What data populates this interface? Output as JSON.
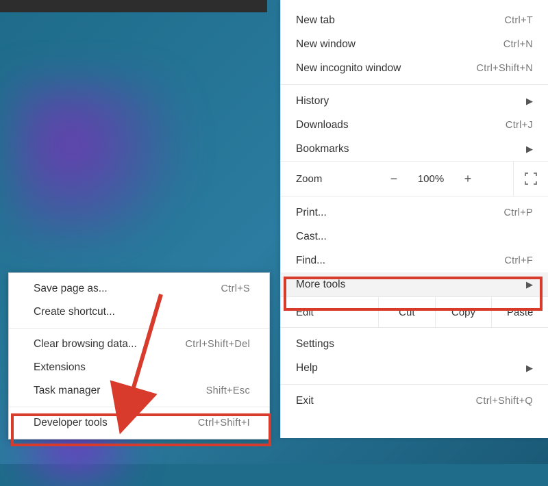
{
  "main_menu": {
    "new_tab": {
      "label": "New tab",
      "shortcut": "Ctrl+T"
    },
    "new_window": {
      "label": "New window",
      "shortcut": "Ctrl+N"
    },
    "new_incognito": {
      "label": "New incognito window",
      "shortcut": "Ctrl+Shift+N"
    },
    "history": {
      "label": "History"
    },
    "downloads": {
      "label": "Downloads",
      "shortcut": "Ctrl+J"
    },
    "bookmarks": {
      "label": "Bookmarks"
    },
    "zoom": {
      "label": "Zoom",
      "value": "100%",
      "minus": "−",
      "plus": "+"
    },
    "print": {
      "label": "Print...",
      "shortcut": "Ctrl+P"
    },
    "cast": {
      "label": "Cast..."
    },
    "find": {
      "label": "Find...",
      "shortcut": "Ctrl+F"
    },
    "more_tools": {
      "label": "More tools"
    },
    "edit": {
      "label": "Edit",
      "cut": "Cut",
      "copy": "Copy",
      "paste": "Paste"
    },
    "settings": {
      "label": "Settings"
    },
    "help": {
      "label": "Help"
    },
    "exit": {
      "label": "Exit",
      "shortcut": "Ctrl+Shift+Q"
    }
  },
  "submenu": {
    "save_page": {
      "label": "Save page as...",
      "shortcut": "Ctrl+S"
    },
    "create_shortcut": {
      "label": "Create shortcut..."
    },
    "clear_data": {
      "label": "Clear browsing data...",
      "shortcut": "Ctrl+Shift+Del"
    },
    "extensions": {
      "label": "Extensions"
    },
    "task_manager": {
      "label": "Task manager",
      "shortcut": "Shift+Esc"
    },
    "dev_tools": {
      "label": "Developer tools",
      "shortcut": "Ctrl+Shift+I"
    }
  },
  "annotation_color": "#d83a2b"
}
